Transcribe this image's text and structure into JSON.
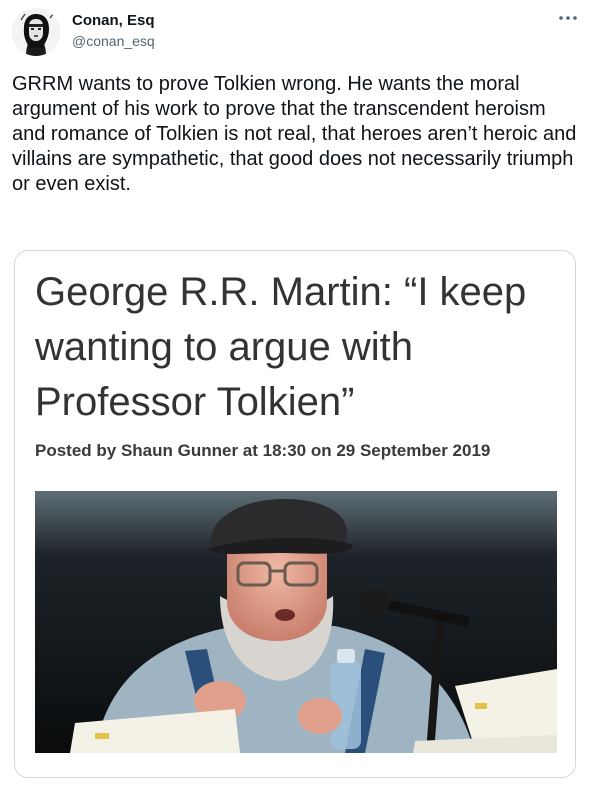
{
  "tweet": {
    "author": {
      "name": "Conan, Esq",
      "handle": "@conan_esq"
    },
    "text": "GRRM wants to prove Tolkien wrong. He wants the moral argument of his work to prove that the transcendent heroism and romance of Tolkien is not real, that heroes aren’t heroic and villains are sympathetic, that good does not necessarily triumph or even exist."
  },
  "card": {
    "headline": "George R.R. Martin: “I keep wanting to argue with Professor Tolkien”",
    "byline": "Posted by Shaun Gunner at 18:30 on 29 September 2019"
  },
  "icons": {
    "more": "more-horizontal-icon"
  }
}
